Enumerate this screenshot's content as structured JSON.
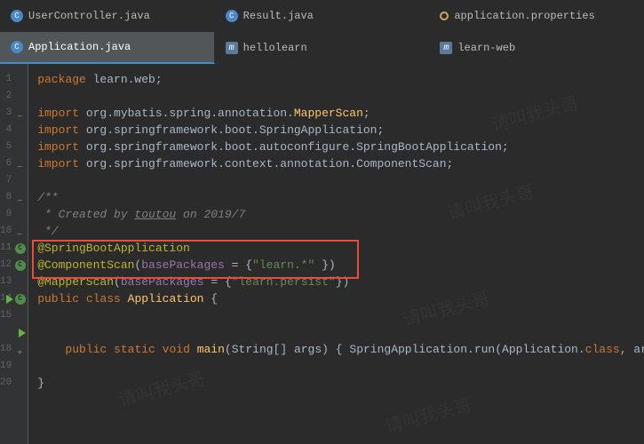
{
  "tabs_row1": [
    {
      "label": "UserController.java",
      "icon": "java"
    },
    {
      "label": "Result.java",
      "icon": "java"
    },
    {
      "label": "application.properties",
      "icon": "props"
    }
  ],
  "tabs_row2": [
    {
      "label": "Application.java",
      "icon": "java",
      "active": true
    },
    {
      "label": "hellolearn",
      "icon": "maven"
    },
    {
      "label": "learn-web",
      "icon": "maven"
    }
  ],
  "code": {
    "line1": {
      "kw": "package",
      "path": " learn.web",
      "end": ";"
    },
    "line3": {
      "kw": "import",
      "path": " org.mybatis.spring.annotation.",
      "cls": "MapperScan",
      "end": ";"
    },
    "line4": {
      "kw": "import",
      "path": " org.springframework.boot.",
      "cls": "SpringApplication",
      "end": ";"
    },
    "line5": {
      "kw": "import",
      "path": " org.springframework.boot.autoconfigure.",
      "cls": "SpringBootApplication",
      "end": ";"
    },
    "line6": {
      "kw": "import",
      "path": " org.springframework.context.annotation.",
      "cls": "ComponentScan",
      "end": ";"
    },
    "line8": "/**",
    "line9a": " * Created by ",
    "line9b": "toutou",
    "line9c": " on 2019/7",
    "line10": " */",
    "line11": "@SpringBootApplication",
    "line12": {
      "ann": "@ComponentScan",
      "open": "(",
      "fld": "basePackages",
      "eq": " = {",
      "str": "\"learn.*\"",
      "close": " })"
    },
    "line13": {
      "ann": "@MapperScan",
      "open": "(",
      "fld": "basePackages",
      "eq": " = {",
      "str": "\"learn.persist\"",
      "close": "})"
    },
    "line14": {
      "kw1": "public",
      "kw2": "class",
      "cls": "Application",
      "brace": "{"
    },
    "line18": {
      "kw1": "public",
      "kw2": "static",
      "kw3": "void",
      "mth": "main",
      "p1": "(",
      "typ": "String",
      "arr": "[]",
      "arg": " args",
      "p2": ") { ",
      "c1": "SpringApplication",
      "dot": ".run(",
      "c2": "Application",
      "dot2": ".",
      "kw4": "class",
      "end": ", args); }"
    },
    "line20": "}"
  },
  "watermark": "请叫我头哥"
}
